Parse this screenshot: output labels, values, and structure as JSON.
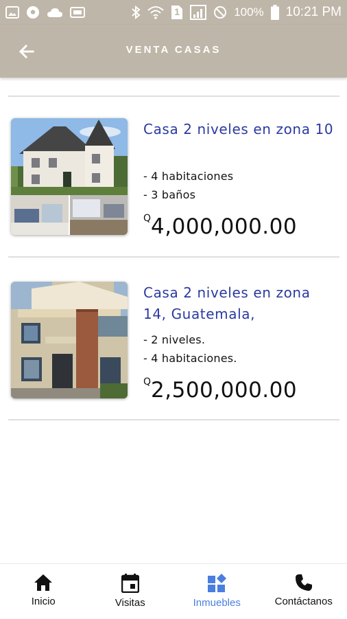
{
  "status_bar": {
    "battery_percent": "100%",
    "time": "10:21 PM",
    "sim_label": "1",
    "icons_left": [
      "image-icon",
      "soccer-ball-icon",
      "cloud-icon",
      "sim-card-icon"
    ],
    "icons_right": [
      "bluetooth-icon",
      "wifi-icon",
      "sim-slot-icon",
      "signal-icon",
      "do-not-disturb-icon",
      "battery-icon"
    ]
  },
  "app_bar": {
    "title": "VENTA CASAS",
    "back_icon": "arrow-left-icon",
    "background": "#beb6a8"
  },
  "listings": [
    {
      "title": "Casa 2 niveles en zona 10",
      "features": [
        "- 4 habitaciones",
        "- 3 baños"
      ],
      "currency": "Q",
      "price": "4,000,000.00"
    },
    {
      "title": "Casa 2 niveles en zona 14, Guatemala,",
      "features": [
        "- 2 niveles.",
        "- 4 habitaciones."
      ],
      "currency": "Q",
      "price": "2,500,000.00"
    }
  ],
  "bottom_nav": {
    "items": [
      {
        "label": "Inicio",
        "icon": "home-icon"
      },
      {
        "label": "Visitas",
        "icon": "calendar-icon"
      },
      {
        "label": "Inmuebles",
        "icon": "dashboard-icon"
      },
      {
        "label": "Contáctanos",
        "icon": "phone-icon"
      }
    ],
    "active": "Inmuebles",
    "active_color": "#4a7ee0"
  },
  "colors": {
    "title_blue": "#2a3aa0",
    "divider": "#dedede"
  }
}
